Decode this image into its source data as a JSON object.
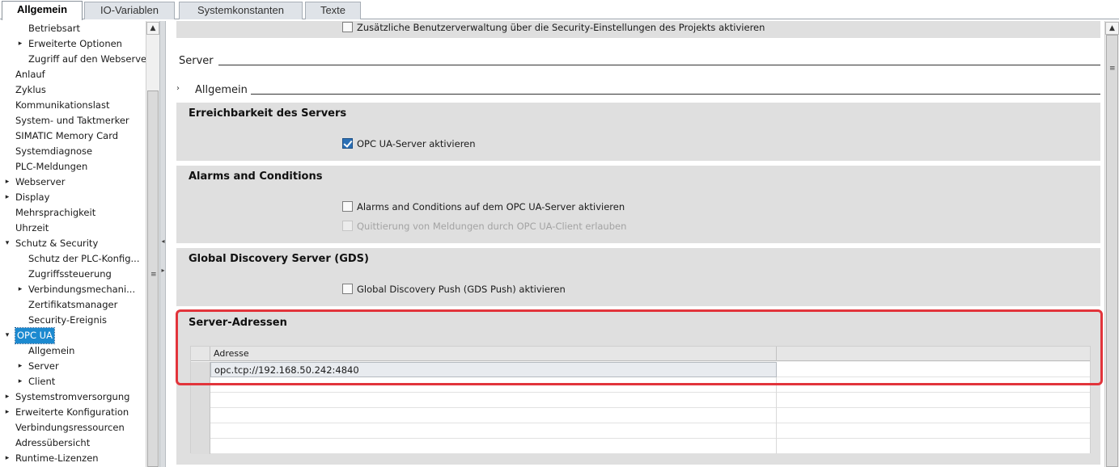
{
  "tabs": [
    {
      "label": "Allgemein",
      "active": true
    },
    {
      "label": "IO-Variablen",
      "active": false
    },
    {
      "label": "Systemkonstanten",
      "active": false
    },
    {
      "label": "Texte",
      "active": false
    }
  ],
  "tree": {
    "items": [
      {
        "label": "Betriebsart",
        "indent": 2,
        "expander": "none"
      },
      {
        "label": "Erweiterte Optionen",
        "indent": 2,
        "expander": "collapsed"
      },
      {
        "label": "Zugriff auf den Webserver",
        "indent": 2,
        "expander": "none"
      },
      {
        "label": "Anlauf",
        "indent": 1,
        "expander": "none"
      },
      {
        "label": "Zyklus",
        "indent": 1,
        "expander": "none"
      },
      {
        "label": "Kommunikationslast",
        "indent": 1,
        "expander": "none"
      },
      {
        "label": "System- und Taktmerker",
        "indent": 1,
        "expander": "none"
      },
      {
        "label": "SIMATIC Memory Card",
        "indent": 1,
        "expander": "none"
      },
      {
        "label": "Systemdiagnose",
        "indent": 1,
        "expander": "none"
      },
      {
        "label": "PLC-Meldungen",
        "indent": 1,
        "expander": "none"
      },
      {
        "label": "Webserver",
        "indent": 1,
        "expander": "collapsed"
      },
      {
        "label": "Display",
        "indent": 1,
        "expander": "collapsed"
      },
      {
        "label": "Mehrsprachigkeit",
        "indent": 1,
        "expander": "none"
      },
      {
        "label": "Uhrzeit",
        "indent": 1,
        "expander": "none"
      },
      {
        "label": "Schutz & Security",
        "indent": 1,
        "expander": "expanded"
      },
      {
        "label": "Schutz der PLC-Konfig...",
        "indent": 2,
        "expander": "none"
      },
      {
        "label": "Zugriffssteuerung",
        "indent": 2,
        "expander": "none"
      },
      {
        "label": "Verbindungsmechani...",
        "indent": 2,
        "expander": "collapsed"
      },
      {
        "label": "Zertifikatsmanager",
        "indent": 2,
        "expander": "none"
      },
      {
        "label": "Security-Ereignis",
        "indent": 2,
        "expander": "none"
      },
      {
        "label": "OPC UA",
        "indent": 1,
        "expander": "expanded",
        "selected": true
      },
      {
        "label": "Allgemein",
        "indent": 2,
        "expander": "none"
      },
      {
        "label": "Server",
        "indent": 2,
        "expander": "collapsed"
      },
      {
        "label": "Client",
        "indent": 2,
        "expander": "collapsed"
      },
      {
        "label": "Systemstromversorgung",
        "indent": 1,
        "expander": "collapsed"
      },
      {
        "label": "Erweiterte Konfiguration",
        "indent": 1,
        "expander": "collapsed"
      },
      {
        "label": "Verbindungsressourcen",
        "indent": 1,
        "expander": "none"
      },
      {
        "label": "Adressübersicht",
        "indent": 1,
        "expander": "none"
      },
      {
        "label": "Runtime-Lizenzen",
        "indent": 1,
        "expander": "collapsed"
      }
    ]
  },
  "main": {
    "top_checkbox": {
      "label": "Zusätzliche Benutzerverwaltung über die Security-Einstellungen des Projekts aktivieren",
      "checked": false
    },
    "section_server": "Server",
    "subsection_general": "Allgemein",
    "panels": {
      "reachability": {
        "title": "Erreichbarkeit des Servers",
        "checkbox": {
          "label": "OPC UA-Server aktivieren",
          "checked": true
        }
      },
      "alarms": {
        "title": "Alarms and Conditions",
        "checkbox1": {
          "label": "Alarms and Conditions auf dem OPC UA-Server aktivieren",
          "checked": false
        },
        "checkbox2": {
          "label": "Quittierung von Meldungen durch OPC UA-Client erlauben",
          "checked": false,
          "disabled": true
        }
      },
      "gds": {
        "title": "Global Discovery Server (GDS)",
        "checkbox": {
          "label": "Global Discovery Push (GDS Push) aktivieren",
          "checked": false
        }
      },
      "addresses": {
        "title": "Server-Adressen",
        "column_header": "Adresse",
        "rows": [
          "opc.tcp://192.168.50.242:4840"
        ]
      }
    }
  },
  "colors": {
    "highlight": "#e2343b",
    "selection": "#1c8ad0",
    "panel_bg": "#dfdfdf",
    "checkbox_checked": "#2a6fb5"
  }
}
